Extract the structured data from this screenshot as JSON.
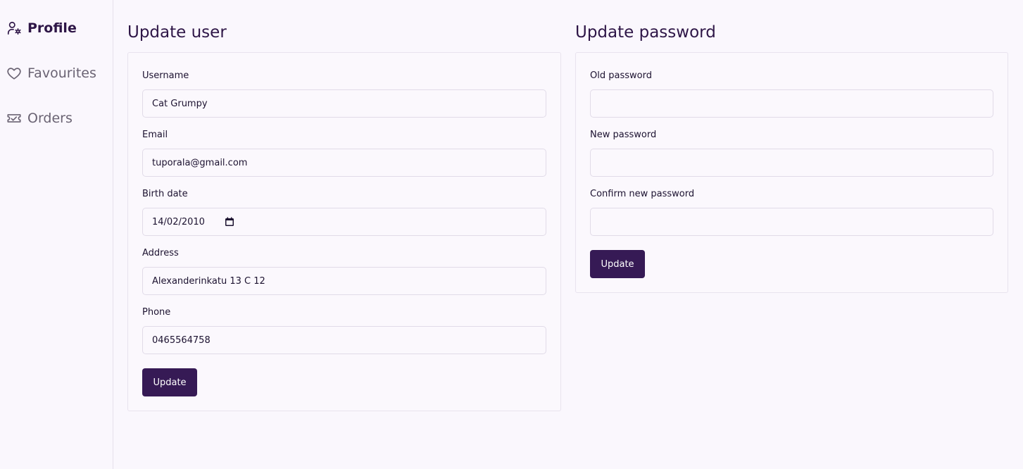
{
  "sidebar": {
    "items": [
      {
        "label": "Profile",
        "icon": "user-gear-icon",
        "active": true
      },
      {
        "label": "Favourites",
        "icon": "heart-icon",
        "active": false
      },
      {
        "label": "Orders",
        "icon": "ticket-icon",
        "active": false
      }
    ]
  },
  "update_user": {
    "title": "Update user",
    "fields": {
      "username": {
        "label": "Username",
        "value": "Cat Grumpy"
      },
      "email": {
        "label": "Email",
        "value": "tuporala@gmail.com"
      },
      "birth_date": {
        "label": "Birth date",
        "value": "14/02/2010"
      },
      "address": {
        "label": "Address",
        "value": "Alexanderinkatu 13 C 12"
      },
      "phone": {
        "label": "Phone",
        "value": "0465564758"
      }
    },
    "submit_label": "Update"
  },
  "update_password": {
    "title": "Update password",
    "fields": {
      "old_password": {
        "label": "Old password",
        "value": ""
      },
      "new_password": {
        "label": "New password",
        "value": ""
      },
      "confirm_password": {
        "label": "Confirm new password",
        "value": ""
      }
    },
    "submit_label": "Update"
  },
  "colors": {
    "accent": "#361a55",
    "background": "#faf7fd",
    "border": "#e1dbe8"
  }
}
